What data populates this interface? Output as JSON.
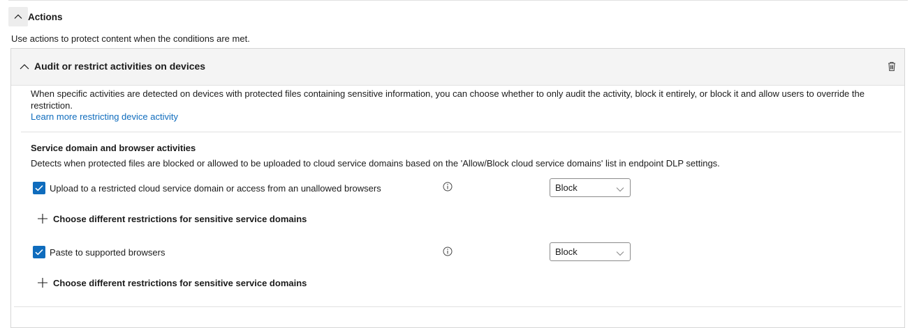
{
  "section": {
    "title": "Actions",
    "intro": "Use actions to protect content when the conditions are met."
  },
  "panel": {
    "title": "Audit or restrict activities on devices",
    "description": "When specific activities are detected on devices with protected files containing sensitive information, you can choose whether to only audit the activity, block it entirely, or block it and allow users to override the restriction.",
    "learn_more": "Learn more restricting device activity",
    "group": {
      "title": "Service domain and browser activities",
      "description": "Detects when protected files are blocked or allowed to be uploaded to cloud service domains based on the 'Allow/Block cloud service domains' list in endpoint DLP settings."
    },
    "activities": [
      {
        "label": "Upload to a restricted cloud service domain or access from an unallowed browsers",
        "checked": true,
        "selected": "Block",
        "add_label": "Choose different restrictions for sensitive service domains"
      },
      {
        "label": "Paste to supported browsers",
        "checked": true,
        "selected": "Block",
        "add_label": "Choose different restrictions for sensitive service domains"
      }
    ]
  },
  "icons": [
    "chevron-up-icon",
    "trash-icon",
    "info-icon",
    "checkmark-icon",
    "chevron-down-icon",
    "plus-icon"
  ],
  "colors": {
    "accent": "#0f6cbd",
    "header_bg": "#f4f4f4"
  }
}
